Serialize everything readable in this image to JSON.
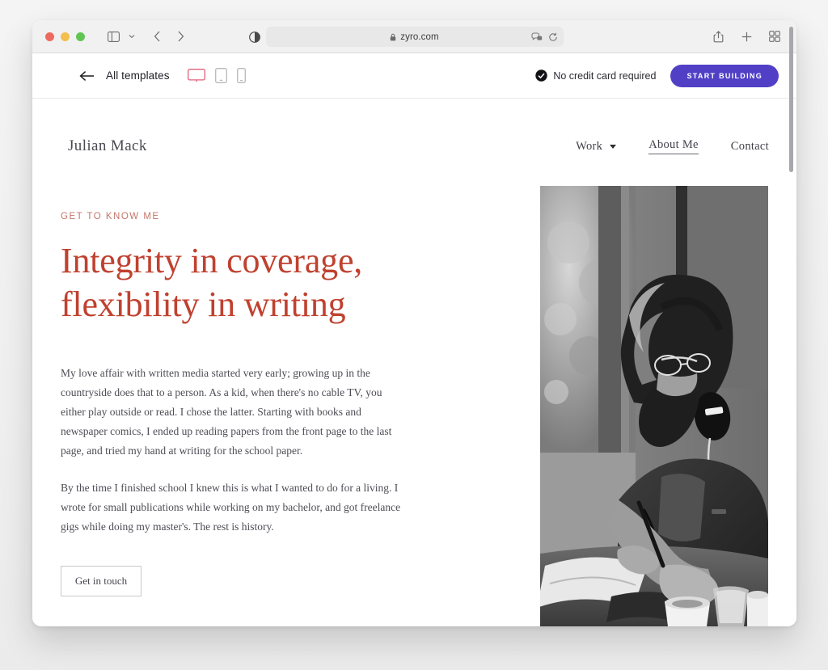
{
  "browser": {
    "traffic_lights": [
      "close",
      "minimize",
      "maximize"
    ],
    "sidebar_icon": "sidebar-icon",
    "sidebar_chevron_icon": "chevron-down-icon",
    "back_icon": "chevron-left-icon",
    "forward_icon": "chevron-right-icon",
    "reader_icon": "reader-contrast-icon",
    "url": "zyro.com",
    "lock_icon": "lock-icon",
    "extension_icon": "extensions-icon",
    "reload_icon": "reload-icon",
    "share_icon": "share-icon",
    "newtab_icon": "plus-icon",
    "tabs_icon": "tab-overview-icon"
  },
  "appbar": {
    "back_icon": "arrow-left-icon",
    "back_label": "All templates",
    "devices": [
      {
        "name": "desktop",
        "icon": "desktop-icon",
        "active": true
      },
      {
        "name": "tablet",
        "icon": "tablet-icon",
        "active": false
      },
      {
        "name": "mobile",
        "icon": "mobile-icon",
        "active": false
      }
    ],
    "notice_icon": "check-circle-icon",
    "notice_text": "No credit card required",
    "cta_label": "START BUILDING",
    "cta_color": "#5140c6"
  },
  "site": {
    "brand": "Julian Mack",
    "nav": [
      {
        "label": "Work",
        "has_dropdown": true,
        "active": false
      },
      {
        "label": "About Me",
        "has_dropdown": false,
        "active": true
      },
      {
        "label": "Contact",
        "has_dropdown": false,
        "active": false
      }
    ],
    "eyebrow": "GET TO KNOW ME",
    "headline_line1": "Integrity in coverage,",
    "headline_line2": "flexibility in writing",
    "headline_color": "#c0412f",
    "paragraph_1": "My love affair with written media started very early; growing up in the countryside does that to a person. As a kid, when there's no cable TV, you either play outside or read. I chose the latter. Starting with books and newspaper comics, I ended up reading papers from the front page to the last page, and tried my hand at writing for the school paper.",
    "paragraph_2": "By the time I finished school I knew this is what I wanted to do for a living. I wrote for small publications while working on my bachelor, and got freelance gigs while doing my master's. The rest is history.",
    "cta_label": "Get in touch",
    "photo_alt": "bearded-man-with-headphones-writing-at-cafe-table"
  }
}
